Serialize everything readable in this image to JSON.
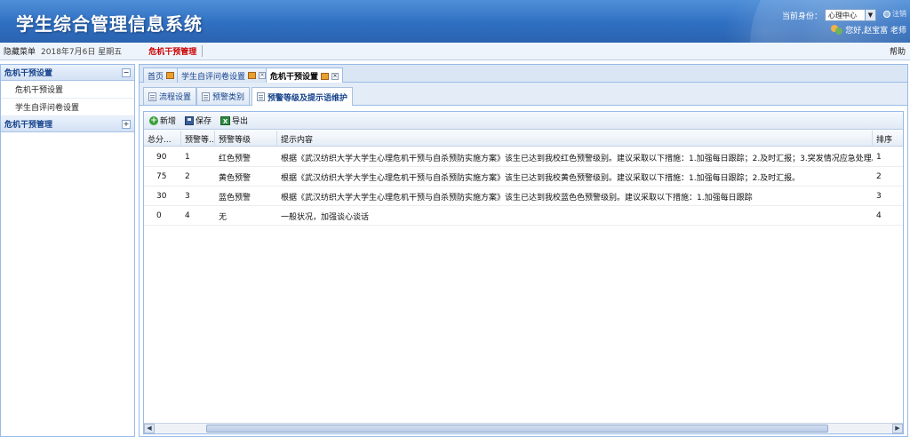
{
  "header": {
    "app_title": "学生综合管理信息系统",
    "identity_label": "当前身份：",
    "role_selected": "心理中心",
    "logout_label": "注销",
    "greeting": "您好,赵宝富 老师"
  },
  "infobar": {
    "hide_menu": "隐藏菜单",
    "date": "2018年7月6日 星期五",
    "current_module": "危机干预管理",
    "help": "帮助"
  },
  "sidebar": {
    "groups": [
      {
        "label": "危机干预设置",
        "toggle": "−",
        "items": [
          {
            "label": "危机干预设置"
          },
          {
            "label": "学生自评问卷设置"
          }
        ]
      },
      {
        "label": "危机干预管理",
        "toggle": "+"
      }
    ]
  },
  "tabs": [
    {
      "label": "首页"
    },
    {
      "label": "学生自评问卷设置"
    },
    {
      "label": "危机干预设置"
    }
  ],
  "subtabs": [
    {
      "label": "流程设置"
    },
    {
      "label": "预警类别"
    },
    {
      "label": "预警等级及提示语维护"
    }
  ],
  "toolbar": {
    "add_label": "新增",
    "save_label": "保存",
    "export_label": "导出"
  },
  "grid": {
    "columns": [
      "总分...",
      "预警等...",
      "预警等级",
      "提示内容",
      "排序"
    ],
    "rows": [
      {
        "score": "90",
        "level_no": "1",
        "level": "红色预警",
        "tip": "根据《武汉纺织大学大学生心理危机干预与自杀预防实施方案》该生已达到我校红色预警级别。建议采取以下措施：1.加强每日跟踪；2.及时汇报；3.突发情况应急处理。",
        "order": "1"
      },
      {
        "score": "75",
        "level_no": "2",
        "level": "黄色预警",
        "tip": "根据《武汉纺织大学大学生心理危机干预与自杀预防实施方案》该生已达到我校黄色预警级别。建议采取以下措施：1.加强每日跟踪；2.及时汇报。",
        "order": "2"
      },
      {
        "score": "30",
        "level_no": "3",
        "level": "蓝色预警",
        "tip": "根据《武汉纺织大学大学生心理危机干预与自杀预防实施方案》该生已达到我校蓝色色预警级别。建议采取以下措施：1.加强每日跟踪",
        "order": "3"
      },
      {
        "score": "0",
        "level_no": "4",
        "level": "无",
        "tip": "一般状况，加强谈心谈话",
        "order": "4"
      }
    ]
  }
}
